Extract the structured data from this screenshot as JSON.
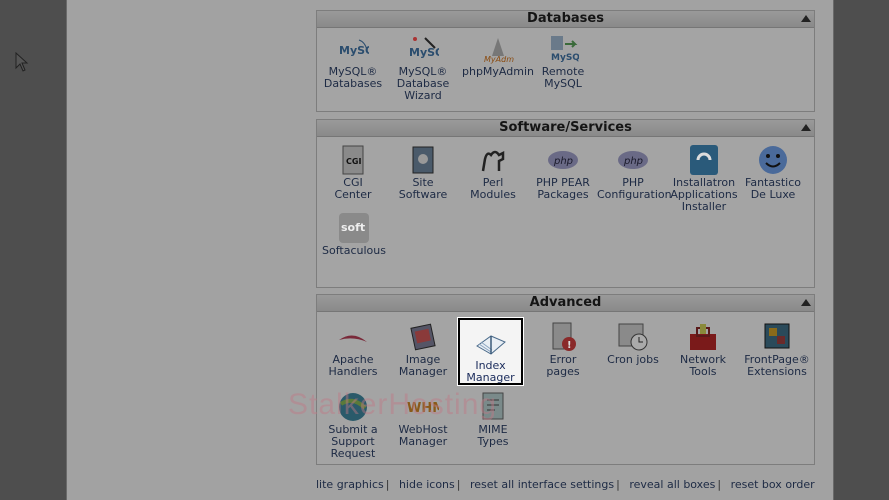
{
  "databases": {
    "title": "Databases",
    "items": [
      {
        "label": "MySQL®\nDatabases",
        "icon": "mysql-icon"
      },
      {
        "label": "MySQL®\nDatabase\nWizard",
        "icon": "mysql-wizard-icon"
      },
      {
        "label": "phpMyAdmin",
        "icon": "phpmyadmin-icon"
      },
      {
        "label": "Remote\nMySQL",
        "icon": "remote-mysql-icon"
      }
    ]
  },
  "software": {
    "title": "Software/Services",
    "items": [
      {
        "label": "CGI\nCenter",
        "icon": "cgi-icon"
      },
      {
        "label": "Site\nSoftware",
        "icon": "site-software-icon"
      },
      {
        "label": "Perl\nModules",
        "icon": "perl-camel-icon"
      },
      {
        "label": "PHP PEAR\nPackages",
        "icon": "php-icon"
      },
      {
        "label": "PHP\nConfiguration",
        "icon": "php-icon"
      },
      {
        "label": "Installatron\nApplications\nInstaller",
        "icon": "installatron-icon"
      },
      {
        "label": "Fantastico\nDe Luxe",
        "icon": "smiley-icon"
      },
      {
        "label": "Softaculous",
        "icon": "softaculous-icon"
      }
    ]
  },
  "advanced": {
    "title": "Advanced",
    "items": [
      {
        "label": "Apache\nHandlers",
        "icon": "feather-icon"
      },
      {
        "label": "Image\nManager",
        "icon": "image-icon"
      },
      {
        "label": "Index\nManager",
        "icon": "book-icon"
      },
      {
        "label": "Error\npages",
        "icon": "error-page-icon"
      },
      {
        "label": "Cron jobs",
        "icon": "calendar-clock-icon"
      },
      {
        "label": "Network\nTools",
        "icon": "toolbox-icon"
      },
      {
        "label": "FrontPage®\nExtensions",
        "icon": "frontpage-icon"
      },
      {
        "label": "Submit a\nSupport\nRequest",
        "icon": "support-globe-icon"
      },
      {
        "label": "WebHost\nManager",
        "icon": "whm-icon"
      },
      {
        "label": "MIME\nTypes",
        "icon": "mime-icon"
      }
    ],
    "whm_text": "WHM",
    "soft_text": "soft",
    "php_text": "php",
    "cgi_text": "CGI"
  },
  "footer": {
    "links": [
      "lite graphics",
      "hide icons",
      "reset all interface settings",
      "reveal all boxes",
      "reset box order"
    ]
  },
  "watermark": "StalkerHosting"
}
